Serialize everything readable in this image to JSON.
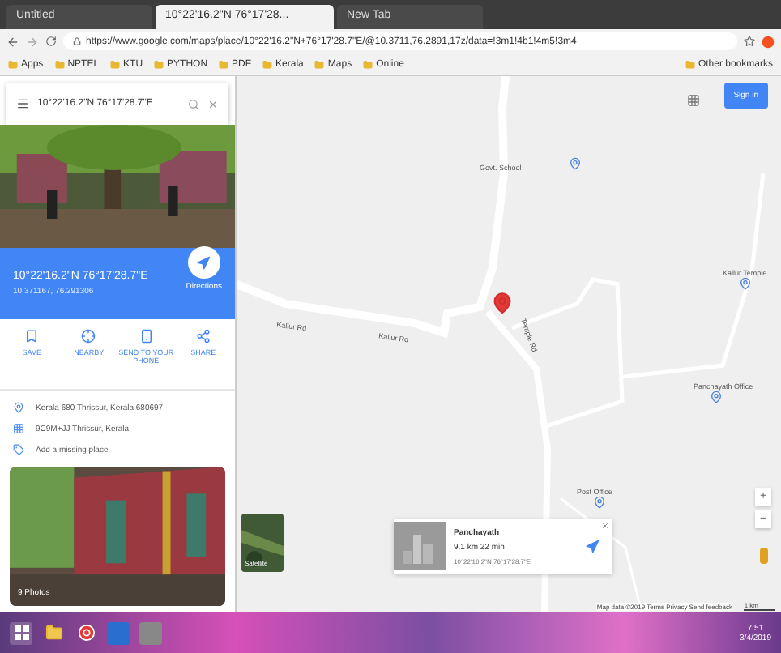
{
  "browser": {
    "tabs": [
      {
        "title": "Untitled",
        "selected": false
      },
      {
        "title": "10°22'16.2\"N 76°17'28...",
        "selected": true
      },
      {
        "title": "New Tab",
        "selected": false
      }
    ],
    "url": "https://www.google.com/maps/place/10°22'16.2\"N+76°17'28.7\"E/@10.3711,76.2891,17z/data=!3m1!4b1!4m5!3m4",
    "bookmarks": [
      "Apps",
      "NPTEL",
      "KTU",
      "PYTHON",
      "PDF",
      "Kerala",
      "Maps",
      "Online"
    ],
    "other_bookmarks": "Other bookmarks"
  },
  "sidebar": {
    "search": "10°22'16.2\"N 76°17'28.7\"E",
    "title": "10°22'16.2\"N 76°17'28.7\"E",
    "subtitle": "10.371167, 76.291306",
    "directions": "Directions",
    "actions": [
      {
        "kind": "save",
        "label": "SAVE"
      },
      {
        "kind": "nearby",
        "label": "NEARBY"
      },
      {
        "kind": "phone",
        "label": "SEND TO YOUR PHONE"
      },
      {
        "kind": "share",
        "label": "SHARE"
      }
    ],
    "info": [
      {
        "kind": "pin",
        "text": "Kerala 680 Thrissur, Kerala 680697"
      },
      {
        "kind": "code",
        "text": "9C9M+JJ Thrissur, Kerala"
      },
      {
        "kind": "label",
        "text": "Add a missing place"
      }
    ],
    "photos_label": "9 Photos"
  },
  "map": {
    "sign_in": "Sign in",
    "places": [
      {
        "name": "Govt. School"
      },
      {
        "name": "Kallur Temple"
      },
      {
        "name": "Panchayath Office"
      },
      {
        "name": "Post Office"
      }
    ],
    "roads": [
      "Kallur Rd",
      "Kallur Rd",
      "Temple Rd"
    ],
    "satellite": "Satellite",
    "card": {
      "title": "Panchayath",
      "line_1": "9.1 km 22 min",
      "line_2": "10°22'16.2\"N 76°17'28.7\"E"
    },
    "zoom_in": "+",
    "zoom_out": "−",
    "footer": "Map data ©2019 Terms Privacy Send feedback",
    "scale": "1 km"
  },
  "taskbar": {
    "time": "7:51",
    "date": "3/4/2019"
  }
}
